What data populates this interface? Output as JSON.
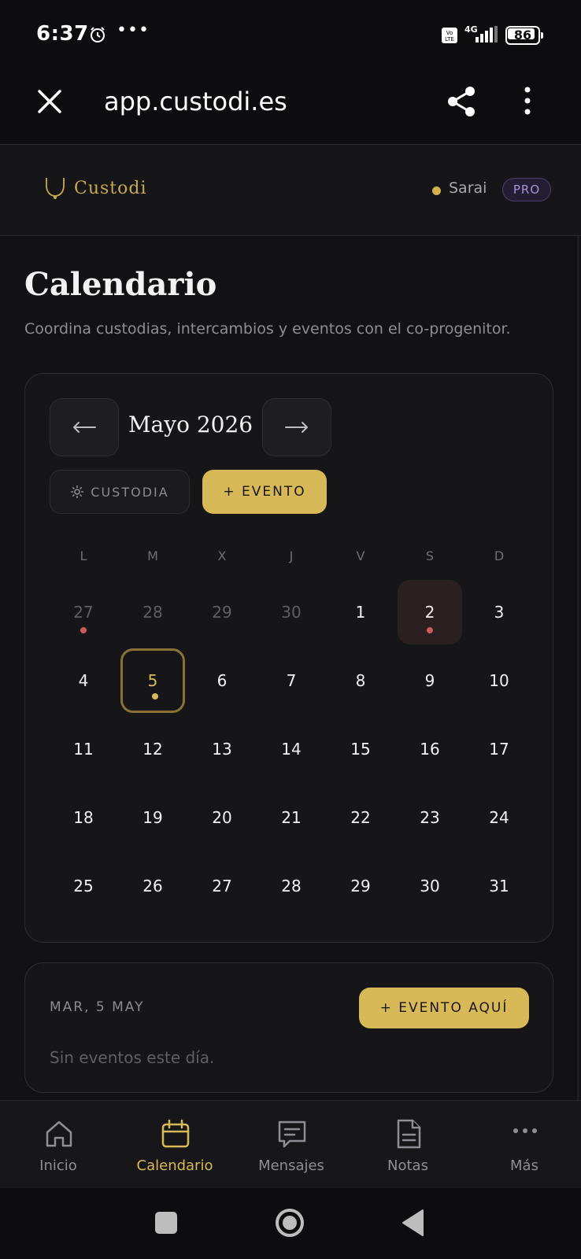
{
  "status_bar": {
    "time": "6:37",
    "more": "•••",
    "network": "4G",
    "battery": "86"
  },
  "browser": {
    "url": "app.custodi.es",
    "close_icon": "close-icon",
    "share_icon": "share-icon",
    "menu_icon": "more-vert-icon"
  },
  "header": {
    "logo_text": "Custodi",
    "user_name": "Sarai",
    "badge": "PRO"
  },
  "page": {
    "title": "Calendario",
    "subtitle": "Coordina custodias, intercambios y eventos con el co-progenitor."
  },
  "calendar": {
    "month_label": "Mayo 2026",
    "custodia_label": "CUSTODIA",
    "add_event_label": "+ EVENTO",
    "weekdays": [
      "L",
      "M",
      "X",
      "J",
      "V",
      "S",
      "D"
    ],
    "weeks": [
      [
        {
          "d": "27",
          "muted": true,
          "dot": "red"
        },
        {
          "d": "28",
          "muted": true
        },
        {
          "d": "29",
          "muted": true
        },
        {
          "d": "30",
          "muted": true
        },
        {
          "d": "1"
        },
        {
          "d": "2",
          "highlight": true,
          "dot": "red"
        },
        {
          "d": "3"
        }
      ],
      [
        {
          "d": "4"
        },
        {
          "d": "5",
          "today": true,
          "dot": "gold"
        },
        {
          "d": "6"
        },
        {
          "d": "7"
        },
        {
          "d": "8"
        },
        {
          "d": "9"
        },
        {
          "d": "10"
        }
      ],
      [
        {
          "d": "11"
        },
        {
          "d": "12"
        },
        {
          "d": "13"
        },
        {
          "d": "14"
        },
        {
          "d": "15"
        },
        {
          "d": "16"
        },
        {
          "d": "17"
        }
      ],
      [
        {
          "d": "18"
        },
        {
          "d": "19"
        },
        {
          "d": "20"
        },
        {
          "d": "21"
        },
        {
          "d": "22"
        },
        {
          "d": "23"
        },
        {
          "d": "24"
        }
      ],
      [
        {
          "d": "25"
        },
        {
          "d": "26"
        },
        {
          "d": "27"
        },
        {
          "d": "28"
        },
        {
          "d": "29"
        },
        {
          "d": "30"
        },
        {
          "d": "31"
        }
      ]
    ],
    "colors": {
      "accent": "#d8b957",
      "red_dot": "#cf5a5a"
    }
  },
  "day_detail": {
    "date_label": "MAR, 5 MAY",
    "add_here_label": "+ EVENTO AQUÍ",
    "empty_text": "Sin eventos este día."
  },
  "bottom_nav": {
    "items": [
      {
        "label": "Inicio",
        "icon": "home-icon"
      },
      {
        "label": "Calendario",
        "icon": "calendar-icon",
        "active": true
      },
      {
        "label": "Mensajes",
        "icon": "message-icon"
      },
      {
        "label": "Notas",
        "icon": "note-icon"
      },
      {
        "label": "Más",
        "icon": "more-horiz-icon"
      }
    ]
  }
}
